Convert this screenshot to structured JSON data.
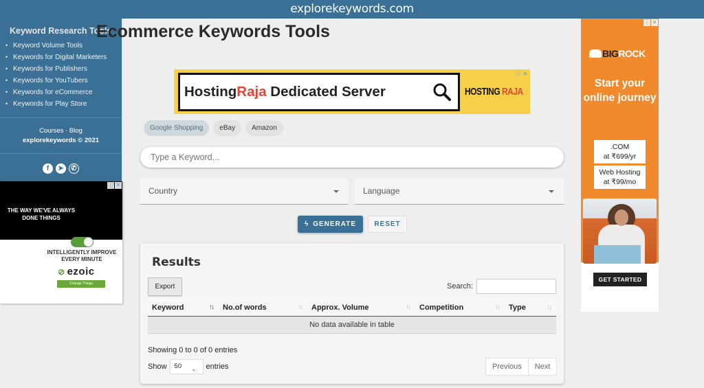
{
  "topbar": {
    "site_name": "explorekeywords.com"
  },
  "sidebar": {
    "heading": "Keyword Research Tools",
    "items": [
      {
        "label": "Keyword Volume Tools"
      },
      {
        "label": "Keywords for Digital Marketers"
      },
      {
        "label": "Keywords for Publishers"
      },
      {
        "label": "Keywords for YouTubers"
      },
      {
        "label": "Keywords for eCommerce"
      },
      {
        "label": "Keywords for Play Store"
      }
    ],
    "footer_links": "Courses · Blog",
    "copyright": "explorekeywords © 2021",
    "social": [
      {
        "name": "facebook-icon",
        "glyph": "f"
      },
      {
        "name": "telegram-icon",
        "glyph": "➤"
      },
      {
        "name": "whatsapp-icon",
        "glyph": "✆"
      }
    ]
  },
  "ad_left": {
    "top_text": "THE WAY WE'VE ALWAYS DONE THINGS",
    "middle_text": "INTELLIGENTLY IMPROVE EVERY MINUTE",
    "brand": "ezoic",
    "brand_glyph": "⊘",
    "cta": "Change Things",
    "badges": [
      "ⓘ",
      "✕"
    ]
  },
  "main": {
    "title": "Ecommerce Keywords Tools",
    "banner": {
      "text_1": "Hosting",
      "text_2": "Raja",
      "text_3": " Dedicated Server",
      "brand_1": "HOSTING ",
      "brand_2": "RAJA",
      "badges": [
        "ⓘ",
        "✕"
      ]
    },
    "chips": [
      {
        "label": "Google Shopping",
        "active": true
      },
      {
        "label": "eBay",
        "active": false
      },
      {
        "label": "Amazon",
        "active": false
      }
    ],
    "search": {
      "placeholder": "Type a Keyword...",
      "value": ""
    },
    "country_select": {
      "label": "Country"
    },
    "language_select": {
      "label": "Language"
    },
    "generate_label": "GENERATE",
    "generate_icon": "ϟ",
    "reset_label": "RESET"
  },
  "results": {
    "heading": "Results",
    "export_label": "Export",
    "search_label": "Search:",
    "search_value": "",
    "columns": [
      {
        "label": "Keyword",
        "sort": "↑↓"
      },
      {
        "label": "No.of words",
        "sort": "↑↓"
      },
      {
        "label": "Approx. Volume",
        "sort": "↑↓"
      },
      {
        "label": "Competition",
        "sort": "↑↓"
      },
      {
        "label": "Type",
        "sort": "↑↓"
      }
    ],
    "empty_message": "No data available in table",
    "info": "Showing 0 to 0 of 0 entries",
    "show_label": "Show",
    "page_size": "50",
    "entries_label": "entries",
    "previous_label": "Previous",
    "next_label": "Next"
  },
  "ad_right": {
    "logo_1": "BIG",
    "logo_2": "ROCK",
    "headline": "Start your online journey",
    "offers": [
      {
        "line1": ".COM",
        "line2": "at ₹699/yr"
      },
      {
        "line1": "Web Hosting",
        "line2": "at ₹99/mo"
      }
    ],
    "cta": "GET STARTED",
    "badges": [
      "ⓘ",
      "✕"
    ]
  }
}
